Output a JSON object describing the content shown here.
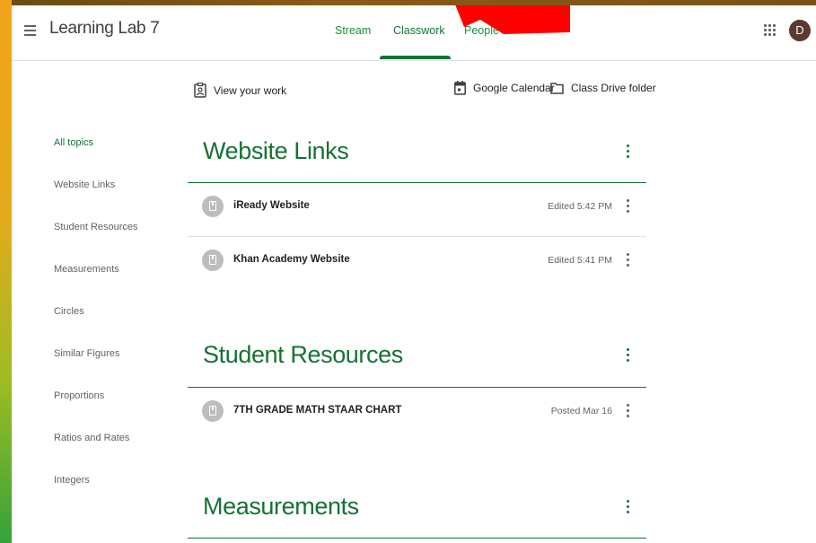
{
  "header": {
    "class_title": "Learning Lab 7",
    "avatar_initial": "D",
    "tabs": [
      {
        "label": "Stream"
      },
      {
        "label": "Classwork"
      },
      {
        "label": "People"
      }
    ]
  },
  "actions": {
    "view_work": "View your work",
    "google_calendar": "Google Calendar",
    "class_drive": "Class Drive folder"
  },
  "sidebar": {
    "items": [
      {
        "label": "All topics"
      },
      {
        "label": "Website Links"
      },
      {
        "label": "Student Resources"
      },
      {
        "label": "Measurements"
      },
      {
        "label": "Circles"
      },
      {
        "label": "Similar Figures"
      },
      {
        "label": "Proportions"
      },
      {
        "label": "Ratios and Rates"
      },
      {
        "label": "Integers"
      }
    ]
  },
  "topics": [
    {
      "title": "Website Links",
      "materials": [
        {
          "title": "iReady Website",
          "meta": "Edited 5:42 PM"
        },
        {
          "title": "Khan Academy Website",
          "meta": "Edited 5:41 PM"
        }
      ]
    },
    {
      "title": "Student Resources",
      "materials": [
        {
          "title": "7TH GRADE MATH STAAR CHART",
          "meta": "Posted Mar 16"
        }
      ]
    },
    {
      "title": "Measurements",
      "materials": []
    }
  ],
  "colors": {
    "accent": "#137333",
    "red_arrow": "#ff0000",
    "avatar_bg": "#5d3a2e"
  },
  "icons": {
    "menu": "hamburger-menu-icon",
    "apps": "google-apps-grid-icon",
    "view_work": "assignment-ind-icon",
    "calendar": "calendar-icon",
    "folder": "folder-icon",
    "more": "more-vert-icon",
    "material": "material-icon"
  }
}
